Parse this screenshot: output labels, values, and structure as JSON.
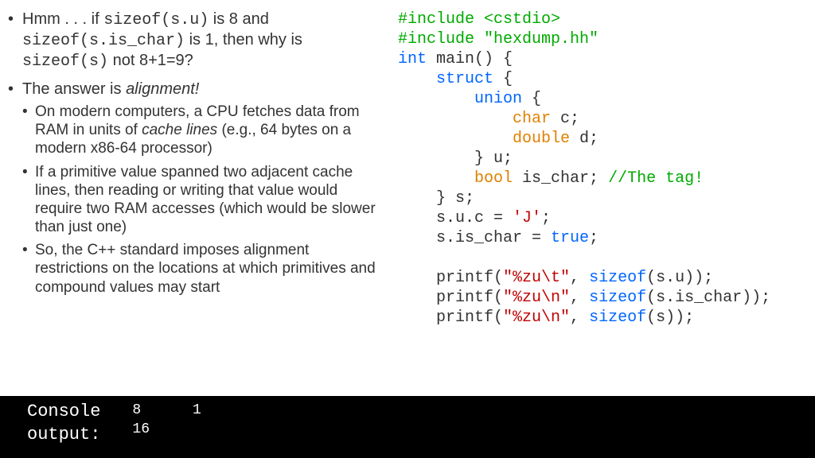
{
  "left": {
    "b1_a": "Hmm . . . if ",
    "b1_code1": "sizeof(s.u)",
    "b1_b": " is 8 and ",
    "b1_code2": "sizeof(s.is_char)",
    "b1_c": " is 1, then why is ",
    "b1_code3": "sizeof(s)",
    "b1_d": " not 8+1=9?",
    "b2_a": "The answer is ",
    "b2_italic": "alignment!",
    "b2s1_a": "On modern computers, a CPU fetches data from RAM in units of ",
    "b2s1_italic": "cache lines",
    "b2s1_b": " (e.g., 64 bytes on a modern x86-64 processor)",
    "b2s2": "If a primitive value spanned two adjacent cache lines, then reading or writing that value would require two RAM accesses (which would be slower than just one)",
    "b2s3": "So, the C++ standard imposes alignment restrictions on the locations at which primitives and compound values may start"
  },
  "code": {
    "l1a": "#include ",
    "l1b": "<cstdio>",
    "l2a": "#include ",
    "l2b": "\"hexdump.hh\"",
    "l3a": "int",
    "l3b": " main() {",
    "l4a": "    ",
    "l4b": "struct",
    "l4c": " {",
    "l5a": "        ",
    "l5b": "union",
    "l5c": " {",
    "l6a": "            ",
    "l6b": "char",
    "l6c": " c;",
    "l7a": "            ",
    "l7b": "double",
    "l7c": " d;",
    "l8": "        } u;",
    "l9a": "        ",
    "l9b": "bool",
    "l9c": " is_char; ",
    "l9d": "//The tag!",
    "l10": "    } s;",
    "l11a": "    s.u.c = ",
    "l11b": "'J'",
    "l11c": ";",
    "l12a": "    s.is_char = ",
    "l12b": "true",
    "l12c": ";",
    "blank": "",
    "l13a": "    printf(",
    "l13b": "\"%zu\\t\"",
    "l13c": ", ",
    "l13d": "sizeof",
    "l13e": "(s.u));",
    "l14a": "    printf(",
    "l14b": "\"%zu\\n\"",
    "l14c": ", ",
    "l14d": "sizeof",
    "l14e": "(s.is_char));",
    "l15a": "    printf(",
    "l15b": "\"%zu\\n\"",
    "l15c": ", ",
    "l15d": "sizeof",
    "l15e": "(s));"
  },
  "console": {
    "label1": "Console",
    "label2": "output:",
    "line1": "8      1",
    "line2": "16"
  }
}
